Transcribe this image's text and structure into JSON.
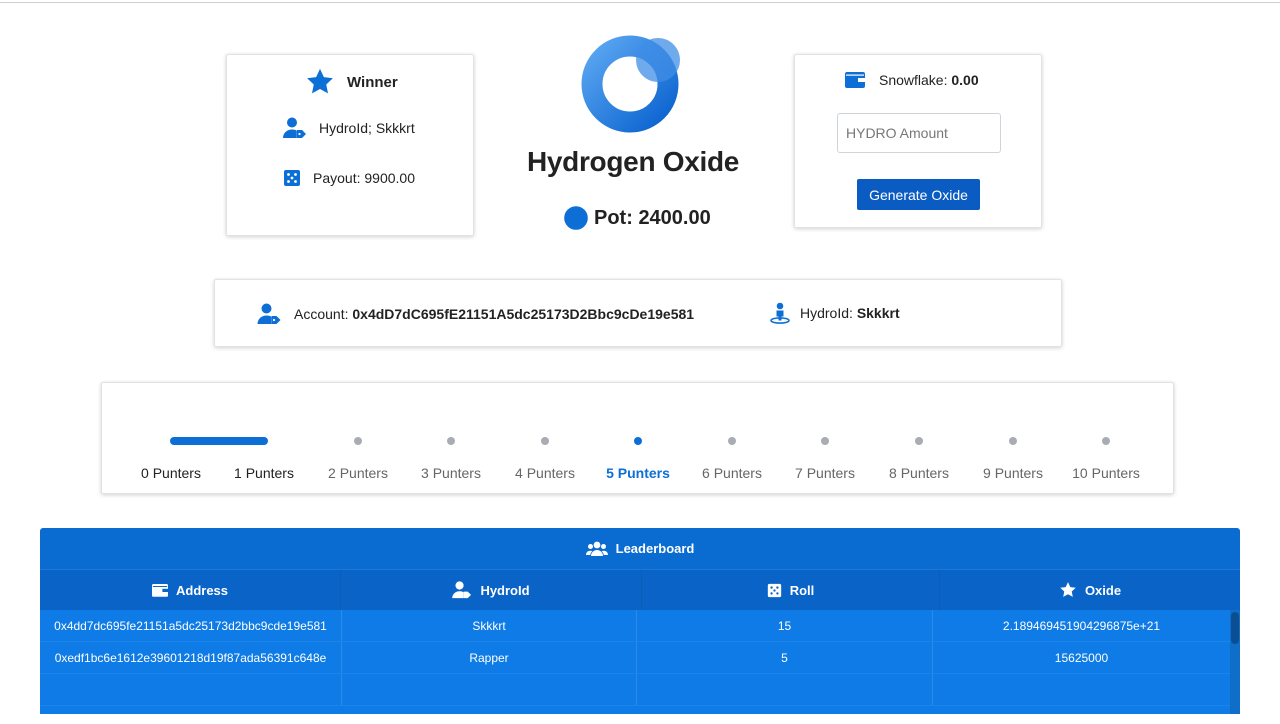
{
  "winner": {
    "title": "Winner",
    "hydroid_label": "HydroId; ",
    "hydroid_value": "Skkkrt",
    "payout_label": "Payout: ",
    "payout_value": "9900.00",
    "icons": [
      "star-icon",
      "user-tag-icon",
      "dice-icon"
    ]
  },
  "header": {
    "title": "Hydrogen Oxide",
    "pot_label": "Pot: ",
    "pot_value": "2400.00",
    "logo": "hydro-ring-logo"
  },
  "snowflake": {
    "label": "Snowflake: ",
    "value": "0.00",
    "input_placeholder": "HYDRO Amount",
    "button_label": "Generate Oxide",
    "icon": "wallet-icon"
  },
  "account": {
    "account_label": "Account: ",
    "account_value": "0x4dD7dC695fE21151A5dc25173D2Bbc9cDe19e581",
    "hydroid_label": "HydroId: ",
    "hydroid_value": "Skkkrt",
    "icons": [
      "user-tag-icon",
      "person-pin-icon"
    ]
  },
  "stepper": {
    "steps": [
      "0 Punters",
      "1 Punters",
      "2 Punters",
      "3 Punters",
      "4 Punters",
      "5 Punters",
      "6 Punters",
      "7 Punters",
      "8 Punters",
      "9 Punters",
      "10 Punters"
    ],
    "active_index": 5
  },
  "leaderboard": {
    "title": "Leaderboard",
    "columns": [
      "Address",
      "HydroId",
      "Roll",
      "Oxide"
    ],
    "rows": [
      [
        "0x4dd7dc695fe21151a5dc25173d2bbc9cde19e581",
        "Skkkrt",
        "15",
        "2.189469451904296875e+21"
      ],
      [
        "0xedf1bc6e1612e39601218d19f87ada56391c648e",
        "Rapper",
        "5",
        "15625000"
      ],
      [
        "",
        "",
        "",
        ""
      ]
    ]
  },
  "colors": {
    "accent": "#0d6fd6",
    "button": "#0b5cc2",
    "table_header": "#0a6cd1",
    "table_body": "#0e7be6"
  }
}
